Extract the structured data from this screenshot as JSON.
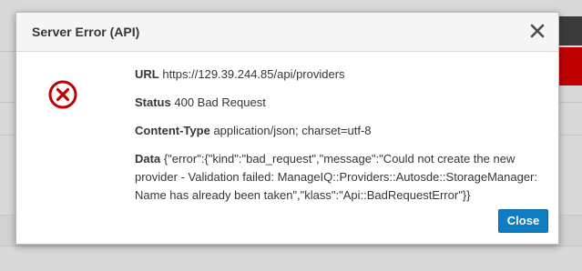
{
  "modal": {
    "title": "Server Error (API)",
    "close_button_label": "Close",
    "icons": {
      "close": "close-icon",
      "error": "error-circle-icon"
    },
    "fields": {
      "url": {
        "label": "URL",
        "value": "https://129.39.244.85/api/providers"
      },
      "status": {
        "label": "Status",
        "value": "400 Bad Request"
      },
      "content_type": {
        "label": "Content-Type",
        "value": "application/json; charset=utf-8"
      },
      "data": {
        "label": "Data",
        "value": "{\"error\":{\"kind\":\"bad_request\",\"message\":\"Could not create the new provider - Validation failed: ManageIQ::Providers::Autosde::StorageManager: Name has already been taken\",\"klass\":\"Api::BadRequestError\"}}"
      }
    }
  },
  "colors": {
    "primary_button": "#0e7dc2",
    "error_icon": "#c00000",
    "background_accent_red": "#c00000",
    "background_accent_dark": "#3b3b3b"
  }
}
